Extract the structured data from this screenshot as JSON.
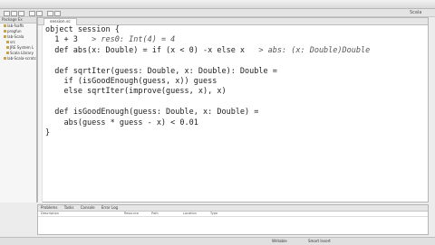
{
  "window": {
    "title": ""
  },
  "perspective": {
    "label": "Scala"
  },
  "sidebar": {
    "header": "Package Ex",
    "items": [
      "lab-fsaffs",
      "progfun",
      "lab-Scala",
      "src",
      "JRE System L",
      "Scala Library",
      "lab-Scala-scratc"
    ]
  },
  "editor": {
    "tab_label": "session.sc",
    "lines": [
      {
        "code": "object session {",
        "result": ""
      },
      {
        "code": "  1 + 3",
        "result": "> res0: Int(4) = 4"
      },
      {
        "code": "  def abs(x: Double) = if (x < 0) -x else x",
        "result": "> abs: (x: Double)Double"
      },
      {
        "code": "",
        "result": ""
      },
      {
        "code": "  def sqrtIter(guess: Double, x: Double): Double =",
        "result": ""
      },
      {
        "code": "    if (isGoodEnough(guess, x)) guess",
        "result": ""
      },
      {
        "code": "    else sqrtIter(improve(guess, x), x)",
        "result": ""
      },
      {
        "code": "",
        "result": ""
      },
      {
        "code": "  def isGoodEnough(guess: Double, x: Double) =",
        "result": ""
      },
      {
        "code": "    abs(guess * guess - x) < 0.01",
        "result": ""
      },
      {
        "code": "}",
        "result": ""
      }
    ]
  },
  "bottom_panel": {
    "tabs": [
      "Problems",
      "Tasks",
      "Console",
      "Error Log"
    ],
    "columns": [
      "Description",
      "Resource",
      "Path",
      "Location",
      "Type"
    ]
  },
  "status": {
    "left": "",
    "mode": "Writable",
    "insert": "Smart Insert"
  }
}
